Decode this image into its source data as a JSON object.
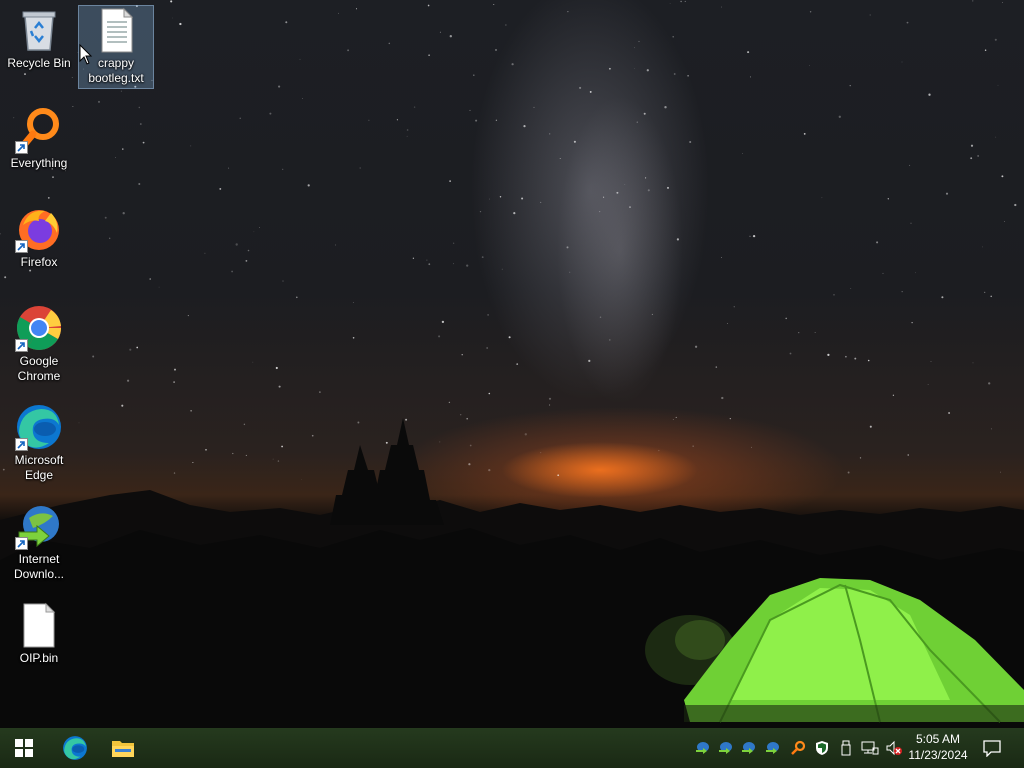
{
  "desktop": {
    "icons": [
      {
        "label": "Recycle Bin",
        "icon": "recycle-bin-icon",
        "shortcut": false,
        "selected": false
      },
      {
        "label": "crappy bootleg.txt",
        "icon": "text-file-icon",
        "shortcut": false,
        "selected": true
      },
      {
        "label": "Everything",
        "icon": "everything-search-icon",
        "shortcut": true,
        "selected": false
      },
      {
        "label": "Firefox",
        "icon": "firefox-icon",
        "shortcut": true,
        "selected": false
      },
      {
        "label": "Google Chrome",
        "icon": "chrome-icon",
        "shortcut": true,
        "selected": false
      },
      {
        "label": "Microsoft Edge",
        "icon": "edge-icon",
        "shortcut": true,
        "selected": false
      },
      {
        "label": "Internet Downlo...",
        "icon": "internet-download-manager-icon",
        "shortcut": true,
        "selected": false
      },
      {
        "label": "OIP.bin",
        "icon": "blank-file-icon",
        "shortcut": false,
        "selected": false
      }
    ]
  },
  "taskbar": {
    "pinned": [
      {
        "name": "Start",
        "icon": "windows-start-icon"
      },
      {
        "name": "Microsoft Edge",
        "icon": "edge-icon"
      },
      {
        "name": "File Explorer",
        "icon": "folder-icon"
      }
    ],
    "tray": [
      {
        "icon": "idm-tray-icon"
      },
      {
        "icon": "idm-tray-icon"
      },
      {
        "icon": "idm-tray-icon"
      },
      {
        "icon": "idm-tray-icon"
      },
      {
        "icon": "everything-tray-icon"
      },
      {
        "icon": "windows-security-icon"
      },
      {
        "icon": "usb-drive-icon"
      },
      {
        "icon": "network-icon"
      },
      {
        "icon": "volume-muted-icon"
      }
    ],
    "clock": {
      "time": "5:05 AM",
      "date": "11/23/2024"
    },
    "notification_icon": "action-center-icon"
  },
  "colors": {
    "taskbar": "#1f3219",
    "tent": "#7ee03a",
    "horizon_glow": "#ff7a20"
  }
}
